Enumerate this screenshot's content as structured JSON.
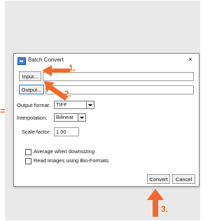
{
  "accent_color": "#f26a2b",
  "edge_mark": "=",
  "dialog": {
    "title": "Batch Convert",
    "close_glyph": "×",
    "input_button": "Input...",
    "output_button": "Output...",
    "input_path": "",
    "output_path": "",
    "output_format": {
      "label": "Output format:",
      "selected": "TIFF"
    },
    "interpolation": {
      "label": "Interpolation:",
      "selected": "Bilinear"
    },
    "scale_factor": {
      "label": "Scale factor:",
      "value": "1.00"
    },
    "checkboxes": [
      {
        "label": "Average when downsizing",
        "checked": false
      },
      {
        "label": "Read images using Bio-Formats",
        "checked": false
      }
    ],
    "convert_button": "Convert",
    "cancel_button": "Cancel"
  },
  "callouts": [
    {
      "number": "1.",
      "points_to": "input-button"
    },
    {
      "number": "2.",
      "points_to": "output-button"
    },
    {
      "number": "3.",
      "points_to": "convert-button"
    }
  ]
}
